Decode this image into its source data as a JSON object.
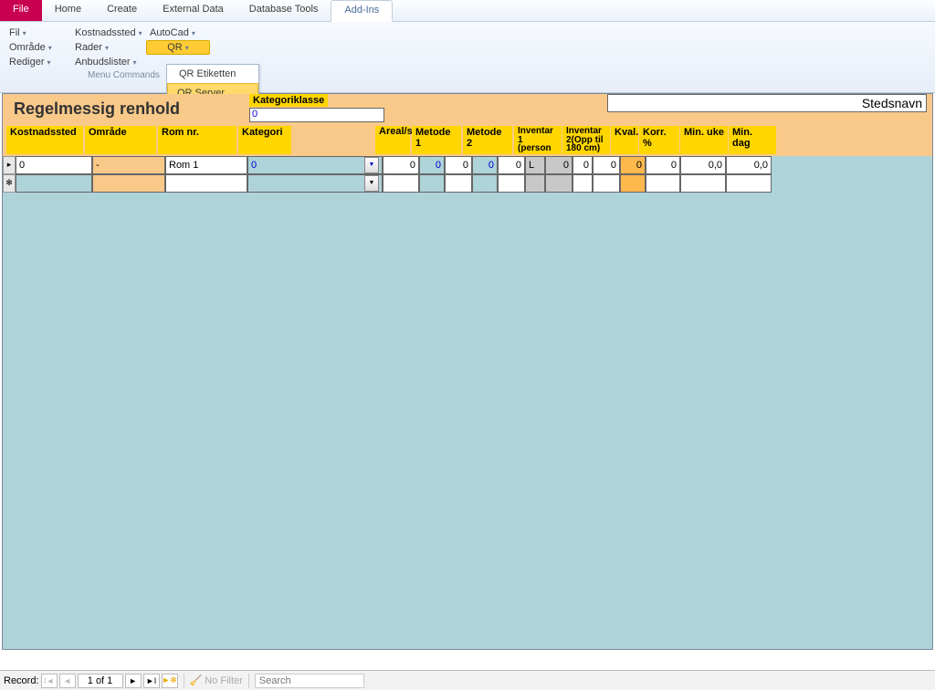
{
  "ribbon": {
    "tabs": [
      "File",
      "Home",
      "Create",
      "External Data",
      "Database Tools",
      "Add-Ins"
    ],
    "active_tab": "Add-Ins",
    "file_tab": "File",
    "items": {
      "fil": "Fil",
      "kostnadssted": "Kostnadssted",
      "autocad": "AutoCad",
      "omrade": "Område",
      "rader": "Rader",
      "qr": "QR",
      "rediger": "Rediger",
      "anbudslister": "Anbudslister"
    },
    "menu_commands": "Menu Commands",
    "qr_menu": {
      "etiketten": "QR Etiketten",
      "server": "QR Server"
    }
  },
  "form": {
    "title": "Regelmessig renhold",
    "kategoriklasse_label": "Kategoriklasse",
    "kategoriklasse_value": "0",
    "stedsnavn_value": "Stedsnavn",
    "columns": {
      "kostnadssted": "Kostnadssted",
      "omrade": "Område",
      "romnr": "Rom nr.",
      "kategori": "Kategori",
      "areal": "Areal/stk.",
      "metode1": "Metode 1",
      "metode2": "Metode 2",
      "inv1": "Inventar 1 (person",
      "inv2": "Inventar 2(Opp til 180 cm)",
      "kval": "Kval.",
      "korr": "Korr. %",
      "minuke": "Min. uke",
      "mindag": "Min. dag"
    },
    "row1": {
      "kostnadssted": "0",
      "omrade": "-",
      "romnr": "Rom 1",
      "kategori": "0",
      "areal": "0",
      "metode1a": "0",
      "metode1b": "0",
      "metode2a": "0",
      "metode2b": "0",
      "inv1a": "L",
      "inv1b": "0",
      "inv2a": "0",
      "inv2b": "0",
      "kval": "0",
      "korr": "0",
      "minuke": "0,0",
      "mindag": "0,0"
    }
  },
  "nav": {
    "label": "Record:",
    "position": "1 of 1",
    "no_filter": "No Filter",
    "search": "Search"
  }
}
